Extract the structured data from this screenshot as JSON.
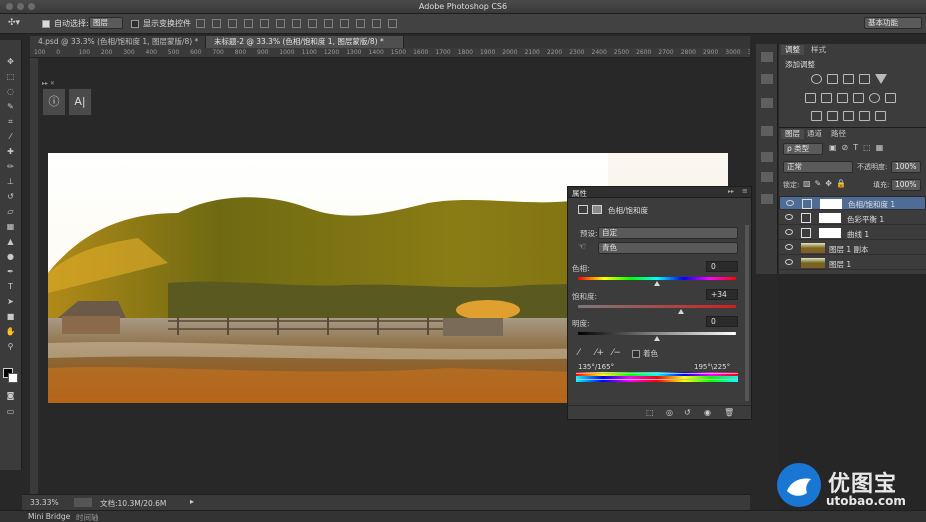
{
  "app": {
    "title": "Adobe Photoshop CS6",
    "workspace": "基本功能"
  },
  "options_bar": {
    "auto_select_label": "自动选择:",
    "auto_select_value": "图层",
    "show_transform_label": "显示变换控件"
  },
  "tabs": [
    {
      "label": "4.psd @ 33.3% (色相/饱和度 1, 图层蒙版/8) *",
      "active": false
    },
    {
      "label": "未标题-2 @ 33.3% (色相/饱和度 1, 图层蒙版/8) *",
      "active": true
    }
  ],
  "ruler": {
    "labels": [
      "100",
      "0",
      "100",
      "200",
      "300",
      "400",
      "500",
      "600",
      "700",
      "800",
      "900",
      "1000",
      "1100",
      "1200",
      "1300",
      "1400",
      "1500",
      "1600",
      "1700",
      "1800",
      "1900",
      "2000",
      "2100",
      "2200",
      "2300",
      "2400",
      "2500",
      "2600",
      "2700",
      "2800",
      "2900",
      "3000",
      "3100"
    ]
  },
  "properties": {
    "title": "属性",
    "adjustment": "色相/饱和度",
    "preset_label": "预设:",
    "preset_value": "自定",
    "channel_value": "青色",
    "hue_label": "色相:",
    "hue_value": "0",
    "saturation_label": "饱和度:",
    "saturation_value": "+34",
    "lightness_label": "明度:",
    "lightness_value": "0",
    "colorize_label": "着色",
    "range_left": "135°/165°",
    "range_right": "195°\\225°"
  },
  "adjust_panel": {
    "tab_adjust": "调整",
    "tab_style": "样式",
    "add_label": "添加调整"
  },
  "layers_panel": {
    "tab_layers": "图层",
    "tab_channels": "通道",
    "tab_paths": "路径",
    "kind_label": "ρ 类型",
    "blend_mode": "正常",
    "opacity_label": "不透明度:",
    "opacity_value": "100%",
    "lock_label": "锁定:",
    "fill_label": "填充:",
    "fill_value": "100%",
    "layers": [
      {
        "name": "色相/饱和度 1",
        "selected": true
      },
      {
        "name": "色彩平衡 1",
        "selected": false
      },
      {
        "name": "曲线 1",
        "selected": false
      },
      {
        "name": "图层 1 副本",
        "selected": false
      },
      {
        "name": "图层 1",
        "selected": false
      }
    ]
  },
  "status": {
    "zoom": "33.33%",
    "doc": "文档:10.3M/20.6M"
  },
  "bottom": {
    "mini_bridge": "Mini Bridge",
    "timeline": "时间轴"
  },
  "watermark": {
    "brand": "优图宝",
    "url": "utobao.com"
  },
  "colors": {
    "accent_selected": "#4e6c96",
    "brand_blue": "#1976d2"
  }
}
